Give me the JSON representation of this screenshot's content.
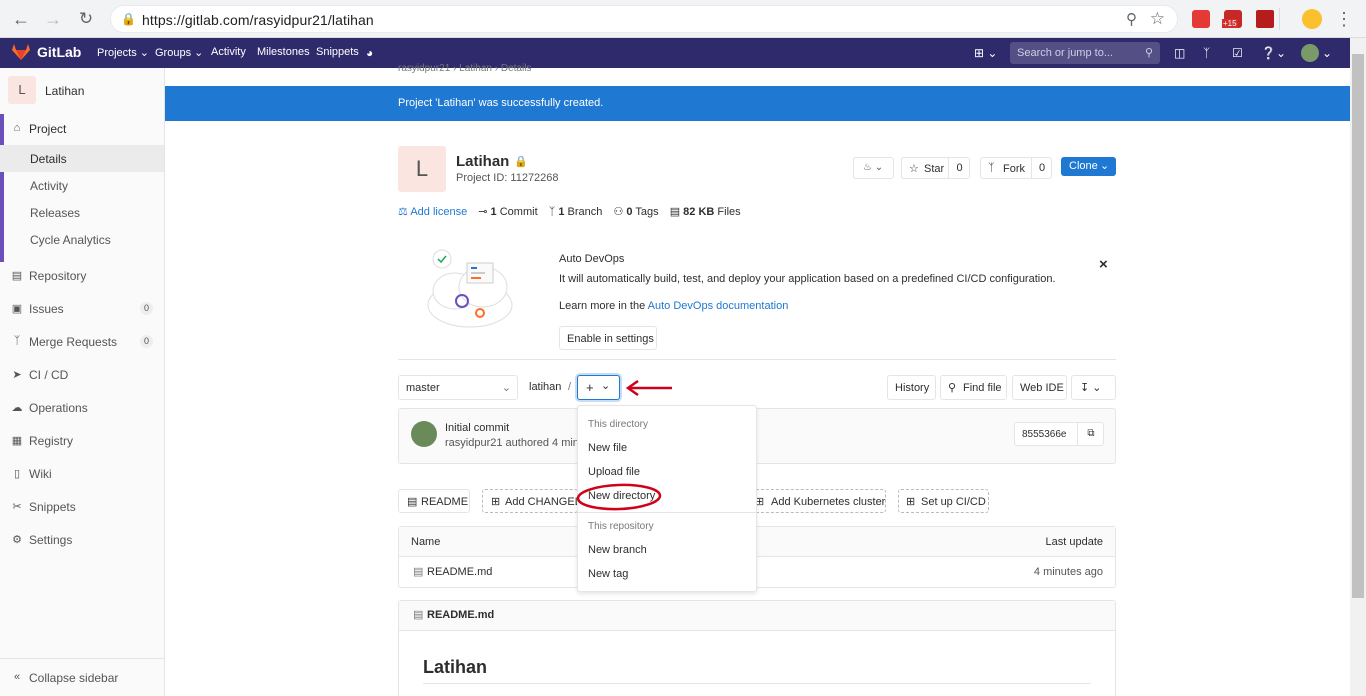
{
  "browser": {
    "url": "https://gitlab.com/rasyidpur21/latihan",
    "ext_badge": "+15"
  },
  "navbar": {
    "brand": "GitLab",
    "items": [
      "Projects",
      "Groups",
      "Activity",
      "Milestones",
      "Snippets"
    ],
    "search_placeholder": "Search or jump to..."
  },
  "sidebar": {
    "project_avatar": "L",
    "project_name": "Latihan",
    "project_section": "Project",
    "sub_items": [
      "Details",
      "Activity",
      "Releases",
      "Cycle Analytics"
    ],
    "items": [
      {
        "label": "Repository",
        "icon": "repository-icon"
      },
      {
        "label": "Issues",
        "count": "0",
        "icon": "issues-icon"
      },
      {
        "label": "Merge Requests",
        "count": "0",
        "icon": "merge-request-icon"
      },
      {
        "label": "CI / CD",
        "icon": "rocket-icon"
      },
      {
        "label": "Operations",
        "icon": "cloud-icon"
      },
      {
        "label": "Registry",
        "icon": "container-icon"
      },
      {
        "label": "Wiki",
        "icon": "book-icon"
      },
      {
        "label": "Snippets",
        "icon": "scissors-icon"
      },
      {
        "label": "Settings",
        "icon": "gear-icon"
      }
    ],
    "collapse_label": "Collapse sidebar"
  },
  "breadcrumb": [
    "rasyidpur21",
    "Latihan",
    "Details"
  ],
  "banner_text": "Project 'Latihan' was successfully created.",
  "project": {
    "avatar": "L",
    "name": "Latihan",
    "id_text": "Project ID: 11272268",
    "star_label": "Star",
    "star_count": "0",
    "fork_label": "Fork",
    "fork_count": "0",
    "clone_label": "Clone",
    "stats": {
      "add_license": "Add license",
      "commits_num": "1",
      "commits_label": "Commit",
      "branch_num": "1",
      "branch_label": "Branch",
      "tags_num": "0",
      "tags_label": "Tags",
      "size_num": "82 KB",
      "size_label": "Files"
    }
  },
  "devops": {
    "title": "Auto DevOps",
    "desc": "It will automatically build, test, and deploy your application based on a predefined CI/CD configuration.",
    "learn_prefix": "Learn more in the",
    "learn_link": "Auto DevOps documentation",
    "enable_button": "Enable in settings",
    "close": "×"
  },
  "repo": {
    "branch": "master",
    "path": "latihan",
    "separator": "/",
    "history": "History",
    "find_file": "Find file",
    "web_ide": "Web IDE"
  },
  "dropdown": {
    "section1": "This directory",
    "items1": [
      "New file",
      "Upload file",
      "New directory"
    ],
    "section2": "This repository",
    "items2": [
      "New branch",
      "New tag"
    ]
  },
  "commit": {
    "title": "Initial commit",
    "meta": "rasyidpur21 authored 4 minu",
    "sha": "8555366e"
  },
  "shortcuts": {
    "readme": "README",
    "add_changelog": "Add CHANGELO",
    "add_k8s": "Add Kubernetes cluster",
    "setup_ci": "Set up CI/CD"
  },
  "files_table": {
    "col_name": "Name",
    "col_update": "Last update",
    "rows": [
      {
        "name": "README.md",
        "update": "4 minutes ago"
      }
    ]
  },
  "readme": {
    "filename": "README.md",
    "heading": "Latihan"
  },
  "colors": {
    "navbar": "#2f2a6b",
    "banner": "#1f78d1",
    "annotation": "#d0021b"
  }
}
